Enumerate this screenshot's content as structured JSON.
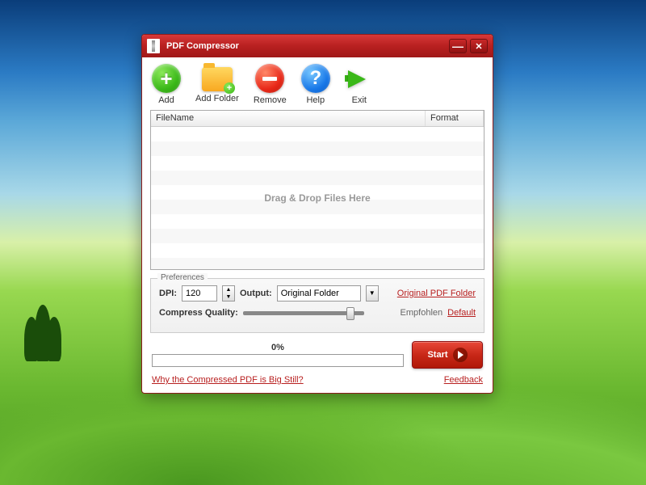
{
  "title": "PDF Compressor",
  "toolbar": {
    "add": "Add",
    "add_folder": "Add Folder",
    "remove": "Remove",
    "help": "Help",
    "exit": "Exit"
  },
  "filelist": {
    "col_filename": "FileName",
    "col_format": "Format",
    "drop_hint": "Drag & Drop Files Here"
  },
  "prefs": {
    "legend": "Preferences",
    "dpi_label": "DPI:",
    "dpi_value": "120",
    "output_label": "Output:",
    "output_value": "Original Folder",
    "original_link": "Original PDF Folder",
    "quality_label": "Compress Quality:",
    "empfohlen": "Empfohlen",
    "default_link": "Default"
  },
  "progress": {
    "pct": "0%"
  },
  "start_label": "Start",
  "footer": {
    "why_link": "Why the Compressed PDF is Big Still?",
    "feedback": "Feedback"
  }
}
